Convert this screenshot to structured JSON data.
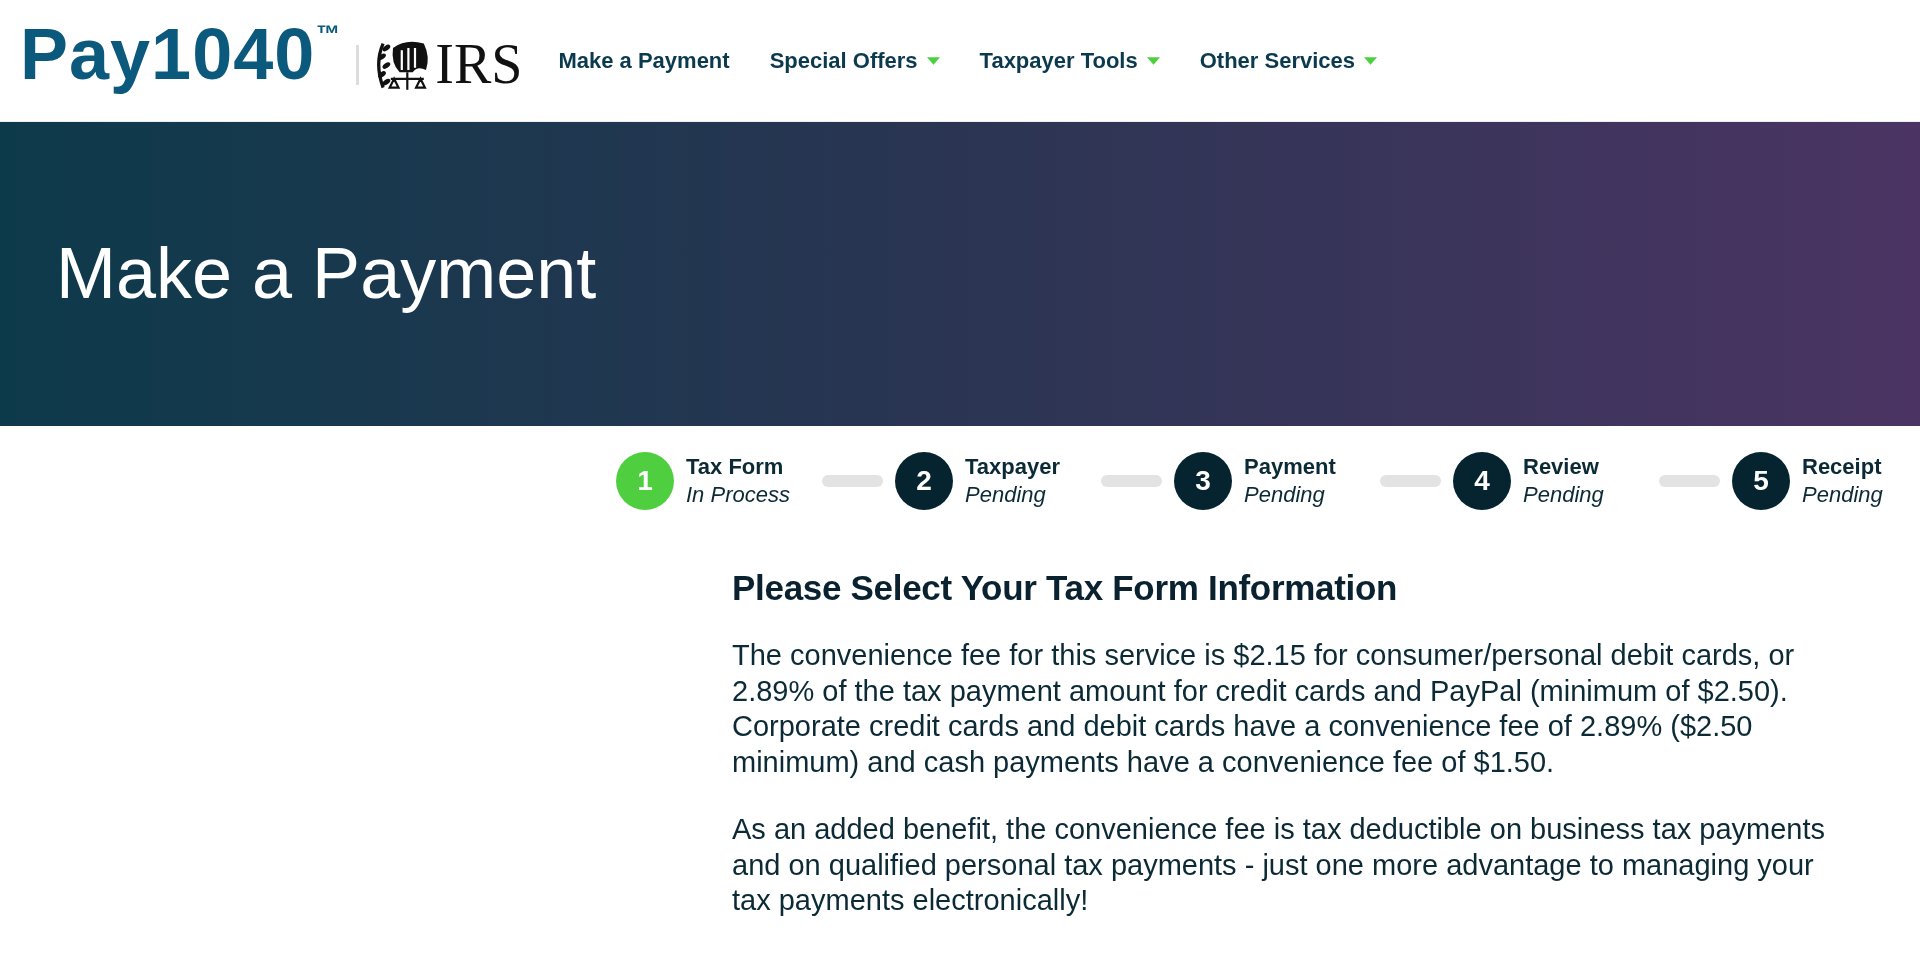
{
  "header": {
    "logo": {
      "text": "Pay1040$^{™}$"
    },
    "partner_logo": {
      "text": "IRS"
    },
    "nav": [
      {
        "label": "Make a Payment",
        "has_menu": false
      },
      {
        "label": "Special Offers",
        "has_menu": true
      },
      {
        "label": "Taxpayer Tools",
        "has_menu": true
      },
      {
        "label": "Other Services",
        "has_menu": true
      }
    ]
  },
  "banner": {
    "title": "Make a Payment"
  },
  "steps": [
    {
      "number": "1",
      "title": "Tax Form",
      "status": "In Process",
      "active": true
    },
    {
      "number": "2",
      "title": "Taxpayer",
      "status": "Pending",
      "active": false
    },
    {
      "number": "3",
      "title": "Payment",
      "status": "Pending",
      "active": false
    },
    {
      "number": "4",
      "title": "Review",
      "status": "Pending",
      "active": false
    },
    {
      "number": "5",
      "title": "Receipt",
      "status": "Pending",
      "active": false
    }
  ],
  "content": {
    "heading": "Please Select Your Tax Form Information",
    "paragraphs": [
      "The convenience fee for this service is $2.15 for consumer/personal debit cards, or 2.89% of the tax payment amount for credit cards and PayPal (minimum of $2.50). Corporate credit cards and debit cards have a convenience fee of 2.89% ($2.50 minimum) and cash payments have a convenience fee of $1.50.",
      "As an added benefit, the convenience fee is tax deductible on business tax payments and on qualified personal tax payments - just one more advantage to managing your tax payments electronically!"
    ]
  }
}
